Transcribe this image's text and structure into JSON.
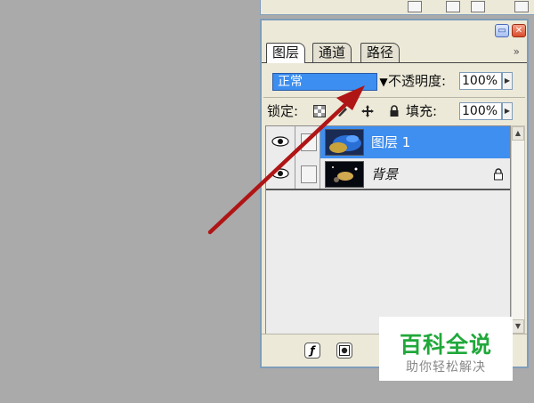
{
  "palette": {
    "tabs": [
      {
        "label": "图层",
        "active": true
      },
      {
        "label": "通道",
        "active": false
      },
      {
        "label": "路径",
        "active": false
      }
    ],
    "more_arrow": "»",
    "blend_mode": "正常",
    "opacity_label": "不透明度:",
    "opacity_value": "100%",
    "lock_label": "锁定:",
    "fill_label": "填充:",
    "fill_value": "100%",
    "layers": [
      {
        "name": "图层 1",
        "selected": true,
        "visible": true,
        "locked": false
      },
      {
        "name": "背景",
        "selected": false,
        "visible": true,
        "locked": true
      }
    ],
    "bottom_buttons": [
      "fx",
      "mask"
    ]
  },
  "icons": {
    "window_menu": "menu-icon",
    "window_close": "close-icon",
    "lock_transparent": "checker-icon",
    "lock_paint": "brush-icon",
    "lock_move": "move-icon",
    "lock_all": "lock-icon",
    "layer_visibility": "eye-icon",
    "fx": "fx-icon",
    "mask": "mask-icon"
  },
  "colors": {
    "selection": "#3f8ff0",
    "annotation_arrow": "#b01515",
    "watermark": "#20a83a"
  },
  "watermark": {
    "title": "百科全说",
    "subtitle": "助你轻松解决"
  }
}
